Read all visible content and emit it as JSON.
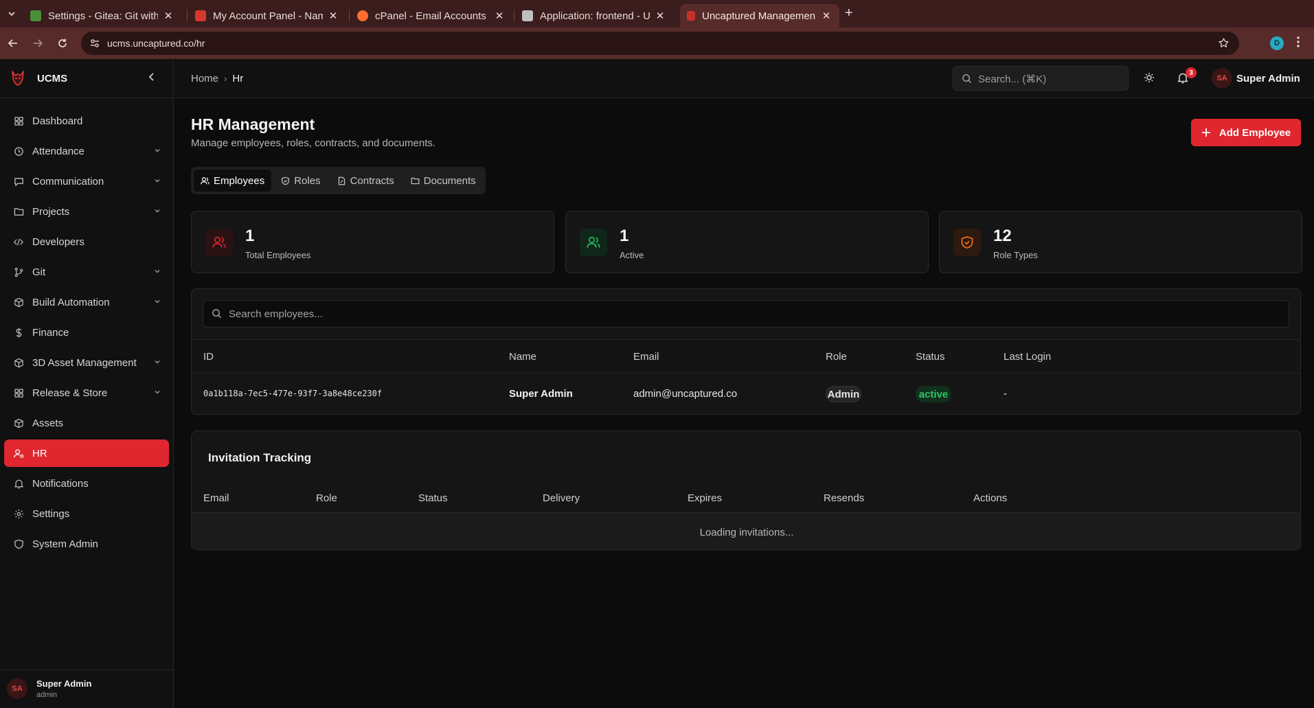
{
  "browser": {
    "tabs": [
      {
        "title": "Settings - Gitea: Git with"
      },
      {
        "title": "My Account Panel - Nam"
      },
      {
        "title": "cPanel - Email Accounts"
      },
      {
        "title": "Application: frontend - U"
      },
      {
        "title": "Uncaptured Managemen"
      }
    ],
    "url": "ucms.uncaptured.co/hr",
    "profile_initial": "D"
  },
  "sidebar": {
    "brand": "UCMS",
    "items": [
      {
        "label": "Dashboard",
        "icon": "grid-icon"
      },
      {
        "label": "Attendance",
        "icon": "clock-icon"
      },
      {
        "label": "Communication",
        "icon": "chat-icon"
      },
      {
        "label": "Projects",
        "icon": "folder-icon"
      },
      {
        "label": "Developers",
        "icon": "code-icon"
      },
      {
        "label": "Git",
        "icon": "git-branch-icon"
      },
      {
        "label": "Build Automation",
        "icon": "box-icon"
      },
      {
        "label": "Finance",
        "icon": "dollar-icon"
      },
      {
        "label": "3D Asset Management",
        "icon": "box-icon"
      },
      {
        "label": "Release & Store",
        "icon": "grid-icon"
      },
      {
        "label": "Assets",
        "icon": "box-icon"
      },
      {
        "label": "HR",
        "icon": "user-cog-icon"
      },
      {
        "label": "Notifications",
        "icon": "bell-icon"
      },
      {
        "label": "Settings",
        "icon": "gear-icon"
      },
      {
        "label": "System Admin",
        "icon": "shield-icon"
      }
    ],
    "user": {
      "initials": "SA",
      "name": "Super Admin",
      "role": "admin"
    }
  },
  "header": {
    "breadcrumb_home": "Home",
    "breadcrumb_current": "Hr",
    "search_placeholder": "Search... (⌘K)",
    "notification_count": "3",
    "user_initials": "SA",
    "user_name": "Super Admin"
  },
  "page": {
    "title": "HR Management",
    "subtitle": "Manage employees, roles, contracts, and documents.",
    "add_button": "Add Employee",
    "tabs": [
      "Employees",
      "Roles",
      "Contracts",
      "Documents"
    ],
    "stats": [
      {
        "value": "1",
        "label": "Total Employees",
        "color": "#e0262f"
      },
      {
        "value": "1",
        "label": "Active",
        "color": "#22c55e"
      },
      {
        "value": "12",
        "label": "Role Types",
        "color": "#f97316"
      }
    ]
  },
  "employees": {
    "search_placeholder": "Search employees...",
    "columns": [
      "ID",
      "Name",
      "Email",
      "Role",
      "Status",
      "Last Login"
    ],
    "rows": [
      {
        "id": "0a1b118a-7ec5-477e-93f7-3a8e48ce230f",
        "name": "Super Admin",
        "email": "admin@uncaptured.co",
        "role": "Admin",
        "status": "active",
        "last_login": "-"
      }
    ]
  },
  "invitations": {
    "title": "Invitation Tracking",
    "columns": [
      "Email",
      "Role",
      "Status",
      "Delivery",
      "Expires",
      "Resends",
      "Actions"
    ],
    "loading_text": "Loading invitations..."
  },
  "colors": {
    "accent": "#e0262f",
    "success": "#32c46a"
  }
}
